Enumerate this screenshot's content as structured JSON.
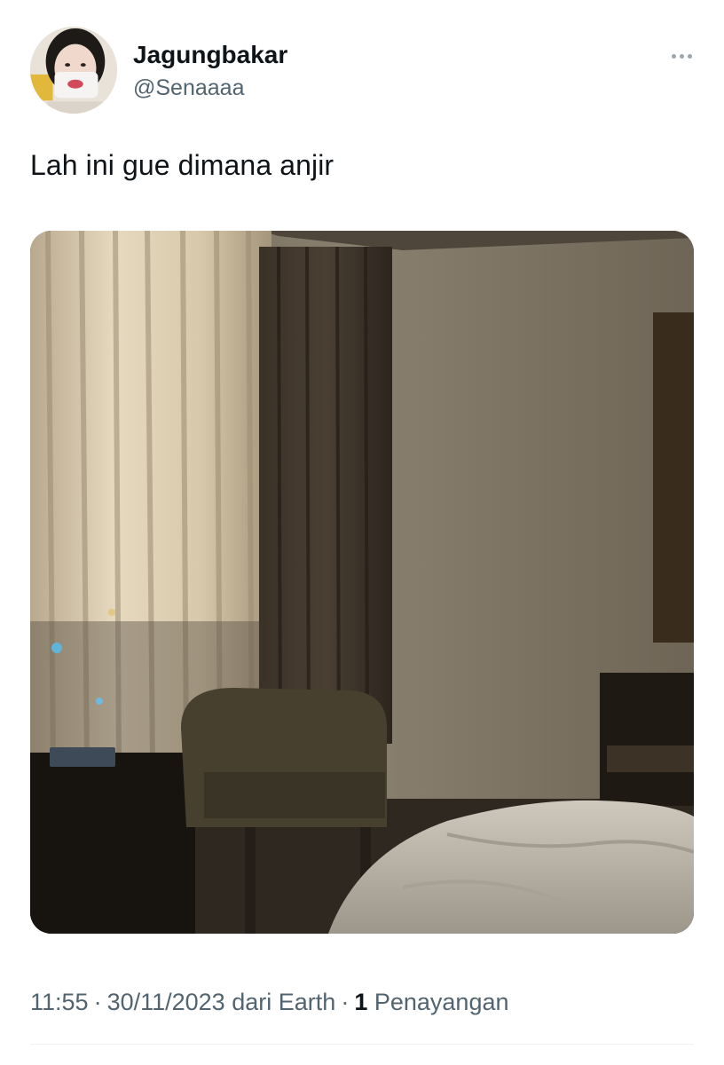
{
  "author": {
    "display_name": "Jagungbakar",
    "handle": "@Senaaaa"
  },
  "tweet": {
    "text": "Lah ini gue dimana anjir"
  },
  "meta": {
    "time": "11:55",
    "date": "30/11/2023",
    "source_prefix": "dari",
    "source": "Earth",
    "separator": "·",
    "views_count": "1",
    "views_label": "Penayangan"
  },
  "icons": {
    "more": "more-horizontal-icon"
  },
  "colors": {
    "text_primary": "#0f1419",
    "text_secondary": "#536471",
    "divider": "#eff3f4"
  }
}
